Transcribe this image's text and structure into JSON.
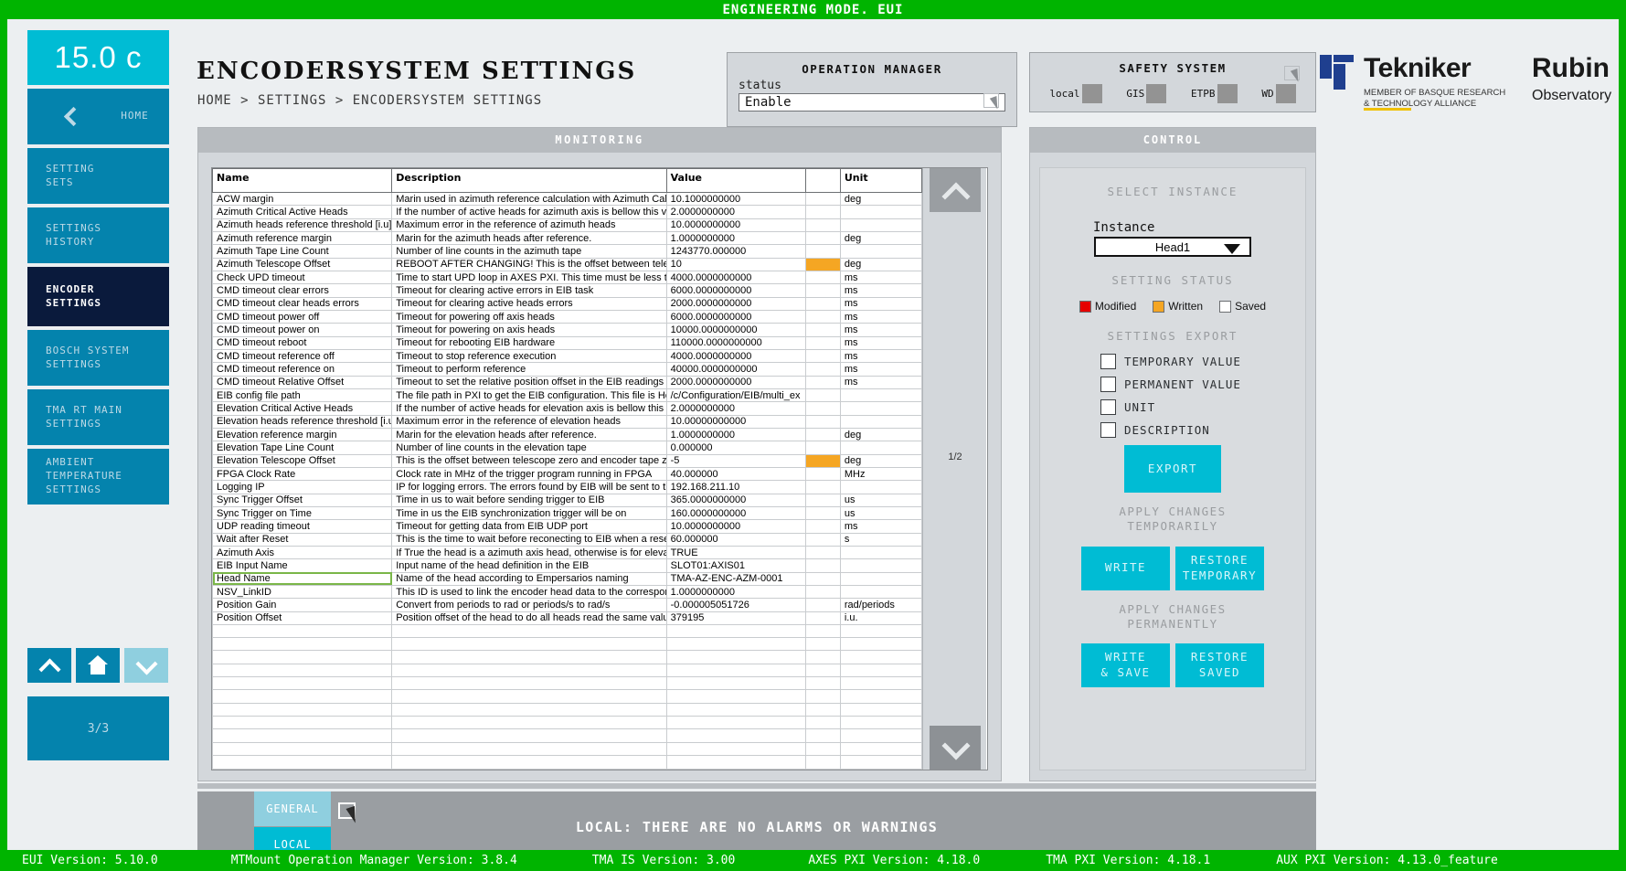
{
  "topbar": {
    "text": "ENGINEERING MODE. EUI"
  },
  "header": {
    "temperature": "15.0 c",
    "title": "ENCODERSYSTEM SETTINGS",
    "breadcrumb": "HOME > SETTINGS > ENCODERSYSTEM SETTINGS"
  },
  "sidebar": {
    "home_label": "HOME",
    "items": [
      {
        "label_1": "SETTING",
        "label_2": "SETS"
      },
      {
        "label_1": "SETTINGS",
        "label_2": "HISTORY"
      },
      {
        "label_1": "ENCODER",
        "label_2": "SETTINGS"
      },
      {
        "label_1": "BOSCH SYSTEM",
        "label_2": "SETTINGS"
      },
      {
        "label_1": "TMA RT MAIN",
        "label_2": "SETTINGS"
      },
      {
        "label_1": "AMBIENT TEMPERATURE",
        "label_2": "SETTINGS"
      }
    ],
    "page_counter": "3/3"
  },
  "operation_manager": {
    "title": "OPERATION MANAGER",
    "status_label": "status",
    "status_value": "Enable"
  },
  "safety_system": {
    "title": "SAFETY SYSTEM",
    "leds": [
      {
        "label": "local"
      },
      {
        "label": "GIS"
      },
      {
        "label": "ETPB"
      },
      {
        "label": "WD"
      }
    ]
  },
  "logos": {
    "tekniker_name": "Tekniker",
    "tekniker_sub_1": "MEMBER OF BASQUE RESEARCH",
    "tekniker_sub_2": "& TECHNOLOGY ALLIANCE",
    "rubin_name": "Rubin",
    "rubin_sub": "Observatory"
  },
  "monitoring": {
    "title": "MONITORING",
    "columns": [
      "Name",
      "Description",
      "Value",
      "",
      "Unit"
    ],
    "page_indicator": "1/2",
    "rows": [
      {
        "name": "ACW margin",
        "desc": "Marin used in azimuth reference calculation with Azimuth Cable Wrap",
        "value": "10.1000000000",
        "sw": "",
        "unit": "deg"
      },
      {
        "name": "Azimuth Critical Active Heads",
        "desc": "If the number of active heads for azimuth axis is bellow this value an a",
        "value": "2.0000000000",
        "sw": "",
        "unit": ""
      },
      {
        "name": "Azimuth heads reference threshold [i.u]",
        "desc": "Maximum error in the reference of azimuth heads",
        "value": "10.0000000000",
        "sw": "",
        "unit": ""
      },
      {
        "name": "Azimuth reference margin",
        "desc": "Marin for the azimuth heads after reference.",
        "value": "1.0000000000",
        "sw": "",
        "unit": "deg"
      },
      {
        "name": "Azimuth Tape Line Count",
        "desc": "Number of line counts in the azimuth tape",
        "value": "1243770.000000",
        "sw": "",
        "unit": ""
      },
      {
        "name": "Azimuth Telescope Offset",
        "desc": "REBOOT AFTER CHANGING! This is the offset between telescope ze",
        "value": "10",
        "sw": "orange",
        "unit": "deg"
      },
      {
        "name": "Check UPD timeout",
        "desc": "Time to start UPD loop in AXES PXI. This time must be less than CMD",
        "value": "4000.0000000000",
        "sw": "",
        "unit": "ms"
      },
      {
        "name": "CMD timeout clear errors",
        "desc": "Timeout for  clearing active errors in EIB task",
        "value": "6000.0000000000",
        "sw": "",
        "unit": "ms"
      },
      {
        "name": "CMD timeout clear heads errors",
        "desc": "Timeout for  clearing active heads errors",
        "value": "2000.0000000000",
        "sw": "",
        "unit": "ms"
      },
      {
        "name": "CMD timeout power off",
        "desc": "Timeout for  powering off axis heads",
        "value": "6000.0000000000",
        "sw": "",
        "unit": "ms"
      },
      {
        "name": "CMD timeout power on",
        "desc": "Timeout for  powering on axis heads",
        "value": "10000.0000000000",
        "sw": "",
        "unit": "ms"
      },
      {
        "name": "CMD timeout reboot",
        "desc": "Timeout for rebooting EIB hardware",
        "value": "110000.0000000000",
        "sw": "",
        "unit": "ms"
      },
      {
        "name": "CMD timeout reference off",
        "desc": "Timeout to stop reference execution",
        "value": "4000.0000000000",
        "sw": "",
        "unit": "ms"
      },
      {
        "name": "CMD timeout reference on",
        "desc": "Timeout to perform reference",
        "value": "40000.0000000000",
        "sw": "",
        "unit": "ms"
      },
      {
        "name": "CMD timeout Relative Offset",
        "desc": "Timeout to set the relative position offset in the EIB readings",
        "value": "2000.0000000000",
        "sw": "",
        "unit": "ms"
      },
      {
        "name": "EIB config file path",
        "desc": "The file path in PXI to get the EIB configuration. This file is Heidenhain",
        "value": "/c/Configuration/EIB/multi_ex",
        "sw": "",
        "unit": ""
      },
      {
        "name": "Elevation Critical Active Heads",
        "desc": "If the number of active heads for elevation axis is bellow this value an",
        "value": "2.0000000000",
        "sw": "",
        "unit": ""
      },
      {
        "name": "Elevation heads reference threshold [i.u",
        "desc": "Maximum error in the reference of elevation heads",
        "value": "10.00000000000",
        "sw": "",
        "unit": ""
      },
      {
        "name": "Elevation reference margin",
        "desc": "Marin for the elevation heads after reference.",
        "value": "1.0000000000",
        "sw": "",
        "unit": "deg"
      },
      {
        "name": "Elevation Tape Line Count",
        "desc": "Number of line counts in the elevation tape",
        "value": "0.000000",
        "sw": "",
        "unit": ""
      },
      {
        "name": "Elevation Telescope Offset",
        "desc": "This is the offset between telescope zero and encoder tape zero for El",
        "value": "-5",
        "sw": "orange",
        "unit": "deg"
      },
      {
        "name": "FPGA Clock Rate",
        "desc": "Clock rate in MHz of the trigger program running in FPGA",
        "value": "40.000000",
        "sw": "",
        "unit": "MHz"
      },
      {
        "name": "Logging IP",
        "desc": "IP for logging errors. The errors found by EIB will be sent to this port",
        "value": "192.168.211.10",
        "sw": "",
        "unit": ""
      },
      {
        "name": "Sync Trigger Offset",
        "desc": "Time in us to wait before sending trigger to EIB",
        "value": "365.0000000000",
        "sw": "",
        "unit": "us"
      },
      {
        "name": "Sync Trigger on Time",
        "desc": "Time in us the EIB synchronization trigger will be on",
        "value": "160.0000000000",
        "sw": "",
        "unit": "us"
      },
      {
        "name": "UDP reading timeout",
        "desc": "Timeout for getting data from EIB UDP port",
        "value": "10.0000000000",
        "sw": "",
        "unit": "ms"
      },
      {
        "name": "Wait after Reset",
        "desc": "This is the time to wait before reconecting to EIB when a reset is perfo",
        "value": "60.000000",
        "sw": "",
        "unit": "s"
      },
      {
        "name": "Azimuth Axis",
        "desc": "If True the head is a azimuth axis head, otherwise is for elevation",
        "value": "TRUE",
        "sw": "",
        "unit": ""
      },
      {
        "name": "EIB Input Name",
        "desc": "Input name of the head definition in the EIB",
        "value": "SLOT01:AXIS01",
        "sw": "",
        "unit": ""
      },
      {
        "name": "Head Name",
        "desc": "Name of the head according to Empersarios naming",
        "value": "TMA-AZ-ENC-AZM-0001",
        "sw": "",
        "unit": "",
        "selected": true
      },
      {
        "name": "NSV_LinkID",
        "desc": "This ID is used to link the encoder head data to the corresponding NSV",
        "value": "1.0000000000",
        "sw": "",
        "unit": ""
      },
      {
        "name": "Position Gain",
        "desc": "Convert from periods to rad or periods/s to rad/s",
        "value": "-0.000005051726",
        "sw": "",
        "unit": "rad/periods"
      },
      {
        "name": "Position Offset",
        "desc": "Position offset of the head to do all heads read the same value after re",
        "value": "379195",
        "sw": "",
        "unit": "i.u."
      }
    ],
    "empty_rows": 11
  },
  "control": {
    "title": "CONTROL",
    "select_instance_title": "SELECT INSTANCE",
    "instance_label": "Instance",
    "instance_value": "Head1",
    "setting_status_title": "SETTING STATUS",
    "status_legend": [
      {
        "label": "Modified",
        "color": "#e60000"
      },
      {
        "label": "Written",
        "color": "#f5a623"
      },
      {
        "label": "Saved",
        "color": "#ffffff"
      }
    ],
    "settings_export_title": "SETTINGS EXPORT",
    "export_options": [
      {
        "label": "TEMPORARY VALUE",
        "checked": false
      },
      {
        "label": "PERMANENT VALUE",
        "checked": false
      },
      {
        "label": "UNIT",
        "checked": false
      },
      {
        "label": "DESCRIPTION",
        "checked": false
      }
    ],
    "export_button": "EXPORT",
    "apply_temp_title_1": "APPLY CHANGES",
    "apply_temp_title_2": "TEMPORARILY",
    "write_button": "WRITE",
    "restore_temporary_button_1": "RESTORE",
    "restore_temporary_button_2": "TEMPORARY",
    "apply_perm_title_1": "APPLY CHANGES",
    "apply_perm_title_2": "PERMANENTLY",
    "write_save_button_1": "WRITE",
    "write_save_button_2": "& SAVE",
    "restore_saved_button_1": "RESTORE",
    "restore_saved_button_2": "SAVED"
  },
  "footer": {
    "tab_general": "GENERAL",
    "tab_local": "LOCAL",
    "alarm_text": "LOCAL: THERE ARE NO ALARMS OR WARNINGS"
  },
  "versions": {
    "eui": "EUI Version: 5.10.0",
    "opman": "MTMount Operation Manager Version: 3.8.4",
    "tma_is": "TMA IS Version: 3.00",
    "axes_pxi": "AXES PXI Version: 4.18.0",
    "tma_pxi": "TMA PXI Version: 4.18.1",
    "aux_pxi": "AUX PXI Version: 4.13.0_feature"
  }
}
